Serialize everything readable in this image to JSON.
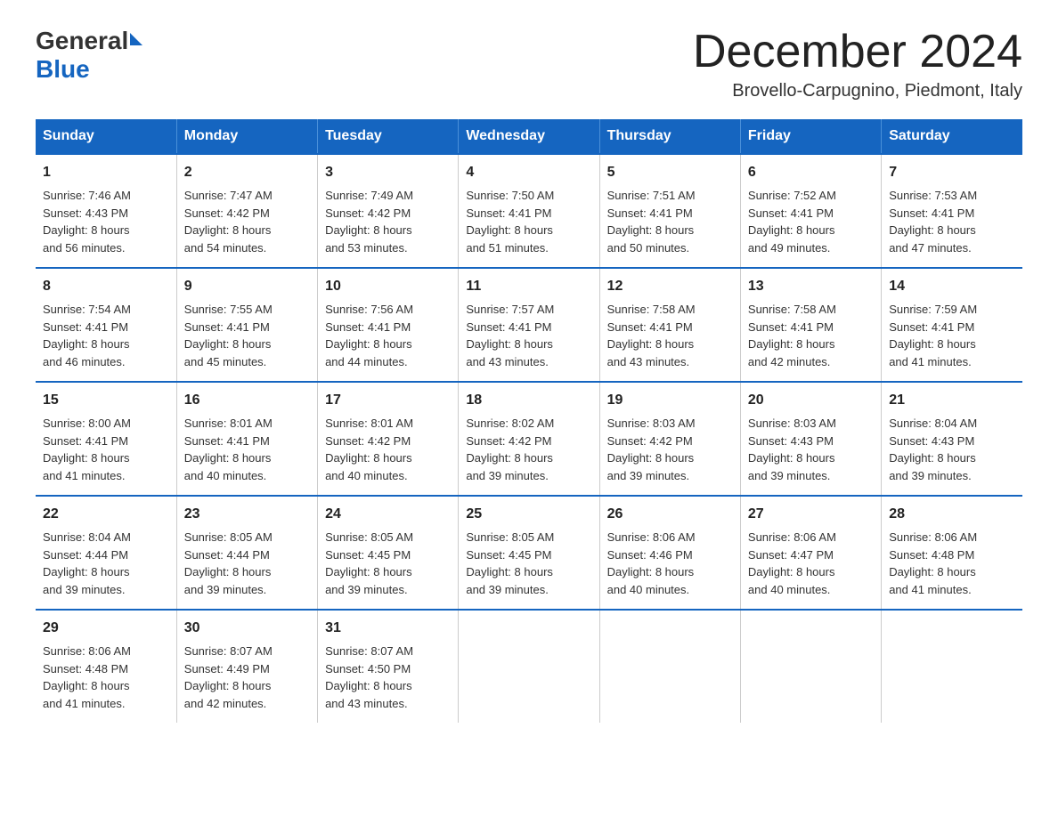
{
  "logo": {
    "general": "General",
    "blue": "Blue"
  },
  "title": "December 2024",
  "location": "Brovello-Carpugnino, Piedmont, Italy",
  "weekdays": [
    "Sunday",
    "Monday",
    "Tuesday",
    "Wednesday",
    "Thursday",
    "Friday",
    "Saturday"
  ],
  "weeks": [
    [
      {
        "day": "1",
        "sunrise": "7:46 AM",
        "sunset": "4:43 PM",
        "daylight": "8 hours and 56 minutes."
      },
      {
        "day": "2",
        "sunrise": "7:47 AM",
        "sunset": "4:42 PM",
        "daylight": "8 hours and 54 minutes."
      },
      {
        "day": "3",
        "sunrise": "7:49 AM",
        "sunset": "4:42 PM",
        "daylight": "8 hours and 53 minutes."
      },
      {
        "day": "4",
        "sunrise": "7:50 AM",
        "sunset": "4:41 PM",
        "daylight": "8 hours and 51 minutes."
      },
      {
        "day": "5",
        "sunrise": "7:51 AM",
        "sunset": "4:41 PM",
        "daylight": "8 hours and 50 minutes."
      },
      {
        "day": "6",
        "sunrise": "7:52 AM",
        "sunset": "4:41 PM",
        "daylight": "8 hours and 49 minutes."
      },
      {
        "day": "7",
        "sunrise": "7:53 AM",
        "sunset": "4:41 PM",
        "daylight": "8 hours and 47 minutes."
      }
    ],
    [
      {
        "day": "8",
        "sunrise": "7:54 AM",
        "sunset": "4:41 PM",
        "daylight": "8 hours and 46 minutes."
      },
      {
        "day": "9",
        "sunrise": "7:55 AM",
        "sunset": "4:41 PM",
        "daylight": "8 hours and 45 minutes."
      },
      {
        "day": "10",
        "sunrise": "7:56 AM",
        "sunset": "4:41 PM",
        "daylight": "8 hours and 44 minutes."
      },
      {
        "day": "11",
        "sunrise": "7:57 AM",
        "sunset": "4:41 PM",
        "daylight": "8 hours and 43 minutes."
      },
      {
        "day": "12",
        "sunrise": "7:58 AM",
        "sunset": "4:41 PM",
        "daylight": "8 hours and 43 minutes."
      },
      {
        "day": "13",
        "sunrise": "7:58 AM",
        "sunset": "4:41 PM",
        "daylight": "8 hours and 42 minutes."
      },
      {
        "day": "14",
        "sunrise": "7:59 AM",
        "sunset": "4:41 PM",
        "daylight": "8 hours and 41 minutes."
      }
    ],
    [
      {
        "day": "15",
        "sunrise": "8:00 AM",
        "sunset": "4:41 PM",
        "daylight": "8 hours and 41 minutes."
      },
      {
        "day": "16",
        "sunrise": "8:01 AM",
        "sunset": "4:41 PM",
        "daylight": "8 hours and 40 minutes."
      },
      {
        "day": "17",
        "sunrise": "8:01 AM",
        "sunset": "4:42 PM",
        "daylight": "8 hours and 40 minutes."
      },
      {
        "day": "18",
        "sunrise": "8:02 AM",
        "sunset": "4:42 PM",
        "daylight": "8 hours and 39 minutes."
      },
      {
        "day": "19",
        "sunrise": "8:03 AM",
        "sunset": "4:42 PM",
        "daylight": "8 hours and 39 minutes."
      },
      {
        "day": "20",
        "sunrise": "8:03 AM",
        "sunset": "4:43 PM",
        "daylight": "8 hours and 39 minutes."
      },
      {
        "day": "21",
        "sunrise": "8:04 AM",
        "sunset": "4:43 PM",
        "daylight": "8 hours and 39 minutes."
      }
    ],
    [
      {
        "day": "22",
        "sunrise": "8:04 AM",
        "sunset": "4:44 PM",
        "daylight": "8 hours and 39 minutes."
      },
      {
        "day": "23",
        "sunrise": "8:05 AM",
        "sunset": "4:44 PM",
        "daylight": "8 hours and 39 minutes."
      },
      {
        "day": "24",
        "sunrise": "8:05 AM",
        "sunset": "4:45 PM",
        "daylight": "8 hours and 39 minutes."
      },
      {
        "day": "25",
        "sunrise": "8:05 AM",
        "sunset": "4:45 PM",
        "daylight": "8 hours and 39 minutes."
      },
      {
        "day": "26",
        "sunrise": "8:06 AM",
        "sunset": "4:46 PM",
        "daylight": "8 hours and 40 minutes."
      },
      {
        "day": "27",
        "sunrise": "8:06 AM",
        "sunset": "4:47 PM",
        "daylight": "8 hours and 40 minutes."
      },
      {
        "day": "28",
        "sunrise": "8:06 AM",
        "sunset": "4:48 PM",
        "daylight": "8 hours and 41 minutes."
      }
    ],
    [
      {
        "day": "29",
        "sunrise": "8:06 AM",
        "sunset": "4:48 PM",
        "daylight": "8 hours and 41 minutes."
      },
      {
        "day": "30",
        "sunrise": "8:07 AM",
        "sunset": "4:49 PM",
        "daylight": "8 hours and 42 minutes."
      },
      {
        "day": "31",
        "sunrise": "8:07 AM",
        "sunset": "4:50 PM",
        "daylight": "8 hours and 43 minutes."
      },
      null,
      null,
      null,
      null
    ]
  ],
  "labels": {
    "sunrise": "Sunrise:",
    "sunset": "Sunset:",
    "daylight": "Daylight:"
  }
}
